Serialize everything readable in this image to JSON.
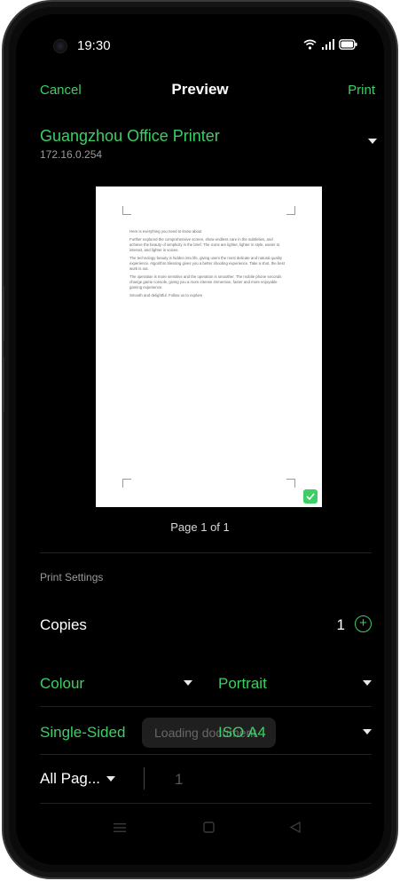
{
  "status": {
    "time": "19:30"
  },
  "header": {
    "cancel": "Cancel",
    "title": "Preview",
    "print": "Print"
  },
  "printer": {
    "name": "Guangzhou Office Printer",
    "ip": "172.16.0.254"
  },
  "preview": {
    "paragraphs": [
      "Here is everything you need to know about",
      "Further explored the comprehensive screen, show endless care in the subtleties, and achieve the beauty of simplicity in the brief. The icons are lighter, lighter in style, easier to interact, and lighter in voices.",
      "The technology beauty is hidden into life, giving users the most delicate and natural quality experience. Algorithm blessing gives you a better shooting experience. Take a shot, the best work is out.",
      "The operation is more sensitive and the operation is smoother. The mobile phone seconds change game console, giving you a more intense immersion, faster and more enjoyable gaming experience.",
      "Smooth and delightful. Follow us to explore"
    ],
    "page_indicator": "Page 1 of 1"
  },
  "settings": {
    "section_title": "Print Settings",
    "copies_label": "Copies",
    "copies_value": "1",
    "colour": "Colour",
    "orientation": "Portrait",
    "duplex": "Single-Sided",
    "paper": "ISO A4",
    "pages": "All Pag...",
    "page_range": "1"
  },
  "toast": "Loading document",
  "colors": {
    "accent": "#3ccf66",
    "background": "#000000"
  }
}
